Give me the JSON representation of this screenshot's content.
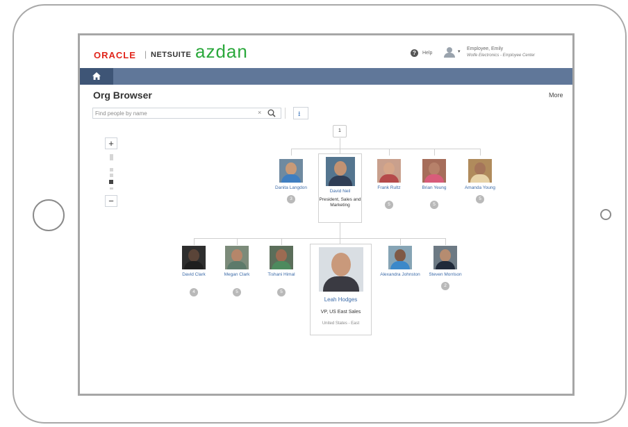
{
  "header": {
    "logo_oracle": "ORACLE",
    "logo_separator": "|",
    "logo_netsuite": "NETSUITE",
    "logo_azdan": "azdan",
    "help_label": "Help",
    "user_name": "Employee, Emily",
    "user_role": "Wolfe Electronics - Employee Center"
  },
  "page": {
    "title": "Org Browser",
    "more_label": "More"
  },
  "search": {
    "placeholder": "Find people by name",
    "value": "",
    "clear": "×"
  },
  "zoom": {
    "in_label": "+",
    "out_label": "−",
    "level": 0.35
  },
  "tree": {
    "root_collapse": "1",
    "level1": [
      {
        "name": "Danita Langdon",
        "count": "3",
        "colors": {
          "skin": "#c99a77",
          "shirt": "#3f7ec0",
          "bg": "#6f8aa0"
        }
      },
      {
        "name": "David Neil",
        "title": "President, Sales and Marketing",
        "selected": true,
        "colors": {
          "skin": "#c29272",
          "shirt": "#2f3d55",
          "bg": "#54758f"
        }
      },
      {
        "name": "Frank Rultz",
        "count": "5",
        "colors": {
          "skin": "#d6a689",
          "shirt": "#b54a4a",
          "bg": "#c9a08d"
        }
      },
      {
        "name": "Brian Yeung",
        "count": "5",
        "colors": {
          "skin": "#b7816a",
          "shirt": "#d85c7a",
          "bg": "#a66d5a"
        }
      },
      {
        "name": "Amanda Young",
        "count": "5",
        "colors": {
          "skin": "#a5755a",
          "shirt": "#e7d3a8",
          "bg": "#b08b5c"
        }
      }
    ],
    "level2": [
      {
        "name": "David Clark",
        "count": "4",
        "colors": {
          "skin": "#5a4438",
          "shirt": "#1f1f1f",
          "bg": "#2e2e2e"
        }
      },
      {
        "name": "Megan Clark",
        "count": "5",
        "colors": {
          "skin": "#b5866a",
          "shirt": "#5d7a6a",
          "bg": "#7c8b7a"
        }
      },
      {
        "name": "Tishani Himal",
        "count": "5",
        "colors": {
          "skin": "#9c6b52",
          "shirt": "#4d8a5e",
          "bg": "#5b6e5a"
        }
      },
      {
        "name": "Leah Hodges",
        "title": "VP, US East Sales",
        "location": "United States - East",
        "selected": true,
        "colors": {
          "skin": "#c9997b",
          "shirt": "#3a3a42",
          "bg": "#d9dee3"
        }
      },
      {
        "name": "Alexandra Johnston",
        "count": "",
        "colors": {
          "skin": "#7f5a46",
          "shirt": "#3b88c9",
          "bg": "#86a4b5"
        }
      },
      {
        "name": "Steven Morrison",
        "count": "2",
        "colors": {
          "skin": "#b68c70",
          "shirt": "#202a3a",
          "bg": "#6d7a84"
        }
      }
    ]
  }
}
